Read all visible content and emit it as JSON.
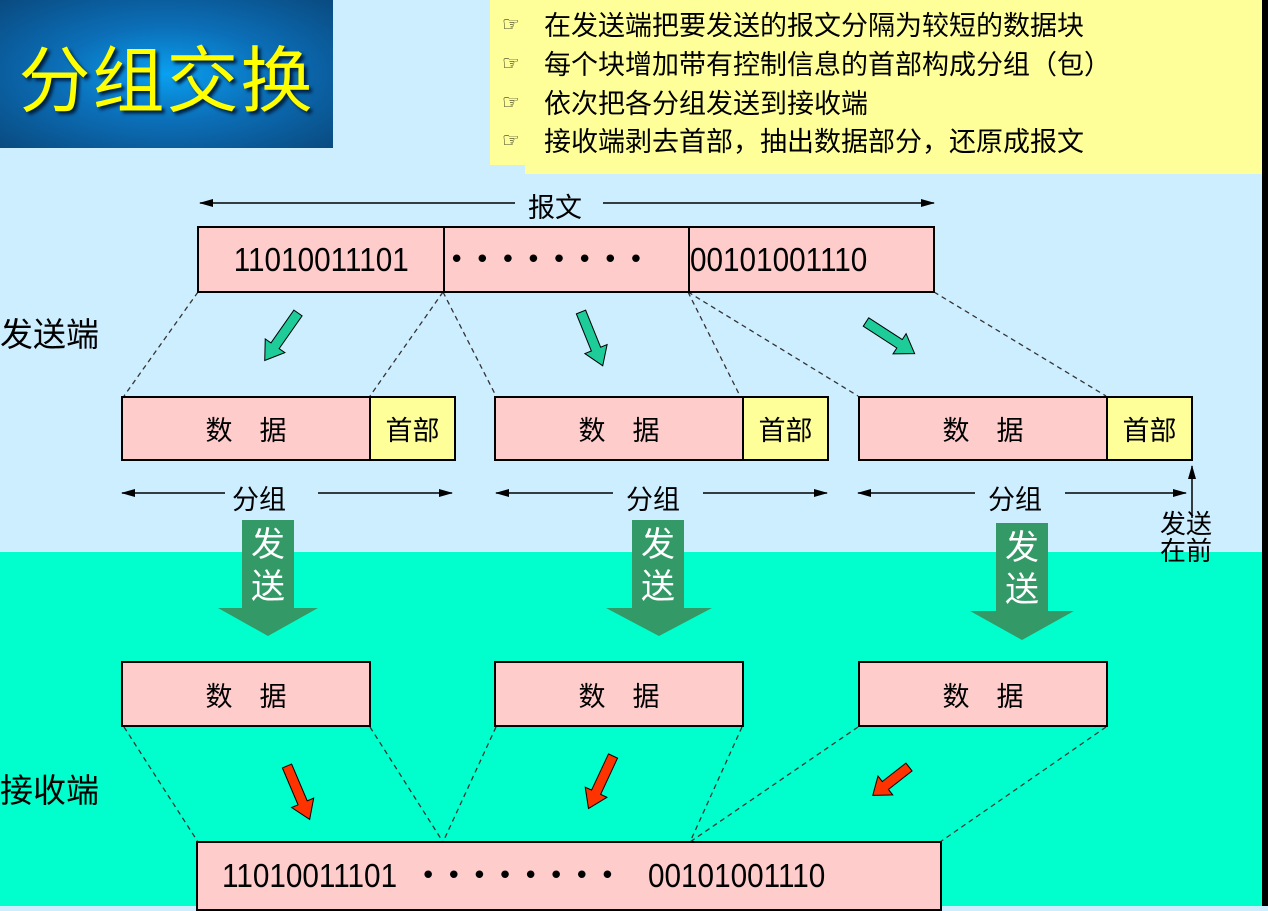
{
  "title": "分组交换",
  "notes": [
    {
      "icon": "pointing-hand-icon",
      "text": "在发送端把要发送的报文分隔为较短的数据块"
    },
    {
      "icon": "pointing-hand-icon",
      "text": "每个块增加带有控制信息的首部构成分组（包）"
    },
    {
      "icon": "pointing-hand-icon",
      "text": "依次把各分组发送到接收端"
    },
    {
      "icon": "pointing-hand-icon",
      "text": "接收端剥去首部，抽出数据部分，还原成报文"
    }
  ],
  "sender_label": "发送端",
  "receiver_label": "接收端",
  "message": {
    "label": "报文",
    "start_bits": "11010011101",
    "dots": "• • • • • • • •",
    "end_bits": "00101001110"
  },
  "packets": [
    {
      "data": "数　据",
      "header": "首部",
      "label": "分组",
      "send": [
        "发",
        "送"
      ]
    },
    {
      "data": "数　据",
      "header": "首部",
      "label": "分组",
      "send": [
        "发",
        "送"
      ]
    },
    {
      "data": "数　据",
      "header": "首部",
      "label": "分组",
      "send": [
        "发",
        "送"
      ]
    }
  ],
  "send_first_note": [
    "发送",
    "在前"
  ],
  "received": [
    {
      "data": "数　据"
    },
    {
      "data": "数　据"
    },
    {
      "data": "数　据"
    }
  ],
  "reassembled": {
    "start_bits": "11010011101",
    "dots": "• • • • • • • •",
    "end_bits": "00101001110"
  },
  "colors": {
    "sender_bg": "#cdeeff",
    "receiver_bg": "#00ffcc",
    "data_fill": "#ffcccc",
    "header_fill": "#ffff99",
    "title_text": "#ffff00",
    "split_arrow": "#1ecc99",
    "reassemble_arrow": "#ff3300",
    "send_arrow": "#339966"
  }
}
